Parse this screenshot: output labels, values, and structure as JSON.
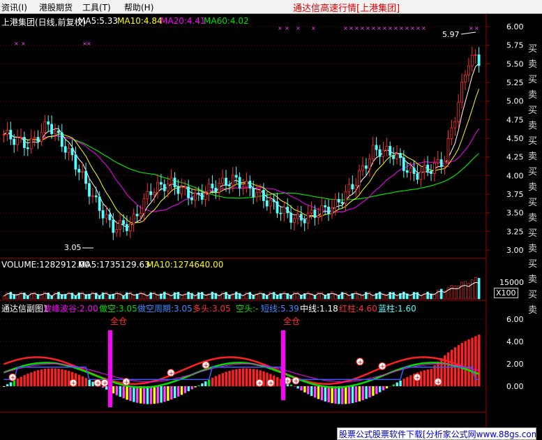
{
  "menu": {
    "items": [
      {
        "label": "资讯(I)"
      },
      {
        "label": "港股期货"
      },
      {
        "label": "工具(T)"
      },
      {
        "label": "帮助(H)"
      }
    ],
    "title": "通达信高速行情[上港集团]"
  },
  "price_panel": {
    "legend": {
      "name": "上港集团(日线,前复权)",
      "ma5": "MA5:5.33",
      "ma10": "MA10:4.84",
      "ma20": "MA20:4.41",
      "ma60": "MA60:4.02"
    },
    "y_ticks": [
      "6.00",
      "5.75",
      "5.50",
      "5.25",
      "5.00",
      "4.75",
      "4.50",
      "4.25",
      "4.00",
      "3.75",
      "3.50",
      "3.25",
      "3.00"
    ],
    "high_label": "5.97",
    "low_label": "3.05",
    "right_vtext": "买卖买卖买卖买卖买卖买卖买卖买卖买卖"
  },
  "volume_panel": {
    "legend": {
      "volume": "VOLUME:1282912.00",
      "ma5": "MA5:1735129.63",
      "ma10": "MA10:1274640.00"
    },
    "y_tick": "15000",
    "unit": "X100"
  },
  "indicator_panel": {
    "legend": {
      "name": "通达信副图1",
      "wave": "波峰波谷:2.00",
      "short": "做空:3.05",
      "short_cycle": "做空周期:3.05",
      "long": "多头:3.05",
      "empty": "空头:-",
      "shortline": "短线:5.39",
      "midline": "中线:1.18",
      "red": "红柱:4.60",
      "blue": "蓝柱:1.60"
    },
    "y_ticks": [
      "6.00",
      "4.00",
      "2.00",
      "0.00"
    ],
    "full_position_label": "全仓"
  },
  "watermark": "股票公式股票软件下载[分析家公式网www.88gs.com]",
  "colors": {
    "up": "#ff3030",
    "down": "#54ffff",
    "ma5": "#ffffff",
    "ma10": "#ffff00",
    "ma20": "#ff00ff",
    "ma60": "#00e000",
    "grid": "#a00000"
  }
}
